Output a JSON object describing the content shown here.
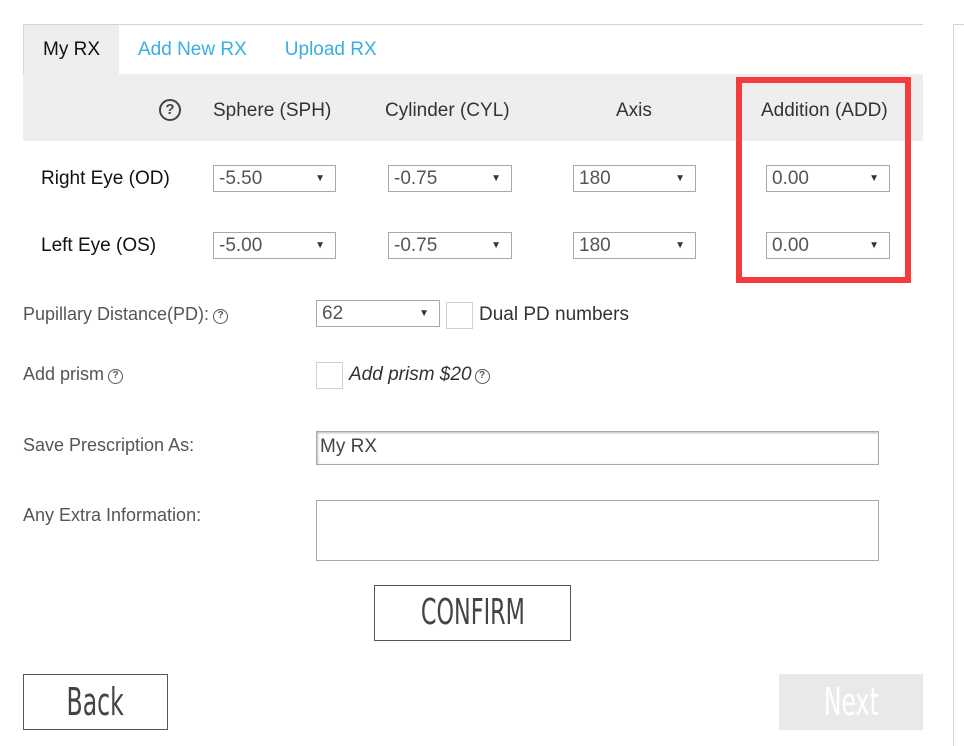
{
  "tabs": [
    {
      "label": "My RX",
      "active": true
    },
    {
      "label": "Add New RX",
      "active": false
    },
    {
      "label": "Upload RX",
      "active": false
    }
  ],
  "table": {
    "help_icon": "question-circle-icon",
    "columns": [
      "Sphere (SPH)",
      "Cylinder (CYL)",
      "Axis",
      "Addition (ADD)"
    ],
    "rows": [
      {
        "label": "Right Eye (OD)",
        "sphere": "-5.50",
        "cylinder": "-0.75",
        "axis": "180",
        "addition": "0.00"
      },
      {
        "label": "Left Eye (OS)",
        "sphere": "-5.00",
        "cylinder": "-0.75",
        "axis": "180",
        "addition": "0.00"
      }
    ],
    "highlight_color": "#f53b3b"
  },
  "pd": {
    "label": "Pupillary Distance(PD):",
    "value": "62",
    "dual_label": "Dual PD numbers",
    "dual_checked": false
  },
  "prism": {
    "label": "Add prism",
    "option_label": "Add prism $20",
    "checked": false
  },
  "save_as": {
    "label": "Save Prescription As:",
    "value": "My RX"
  },
  "extra_info": {
    "label": "Any Extra Information:",
    "value": ""
  },
  "buttons": {
    "confirm": "CONFIRM",
    "back": "Back",
    "next": "Next"
  },
  "colors": {
    "tab_link": "#3aaee0",
    "header_bg": "#eeeeee",
    "next_disabled_bg": "#e9e9e9"
  }
}
